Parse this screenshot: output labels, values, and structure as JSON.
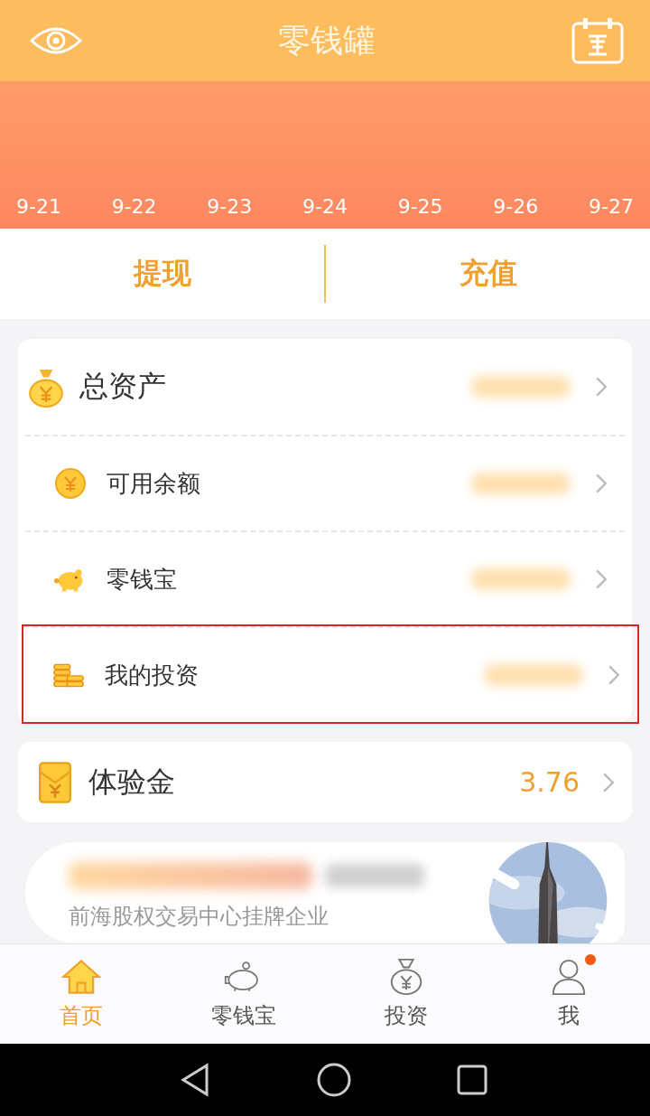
{
  "header": {
    "title": "零钱罐"
  },
  "chart": {
    "dates": [
      "9-21",
      "9-22",
      "9-23",
      "9-24",
      "9-25",
      "9-26",
      "9-27"
    ]
  },
  "actions": [
    "提现",
    "充值"
  ],
  "assets": [
    {
      "kind": "total",
      "label": "总资产",
      "highlighted": false
    },
    {
      "kind": "balance",
      "label": "可用余额",
      "highlighted": false
    },
    {
      "kind": "piggy",
      "label": "零钱宝",
      "highlighted": false
    },
    {
      "kind": "invest",
      "label": "我的投资",
      "highlighted": true
    }
  ],
  "trial": {
    "label": "体验金",
    "value": "3.76"
  },
  "banner": {
    "subtitle": "前海股权交易中心挂牌企业"
  },
  "nav": [
    {
      "kind": "home",
      "label": "首页",
      "selected": true,
      "badge": false
    },
    {
      "kind": "piggy",
      "label": "零钱宝",
      "selected": false,
      "badge": false
    },
    {
      "kind": "bag",
      "label": "投资",
      "selected": false,
      "badge": false
    },
    {
      "kind": "me",
      "label": "我",
      "selected": false,
      "badge": true
    }
  ]
}
